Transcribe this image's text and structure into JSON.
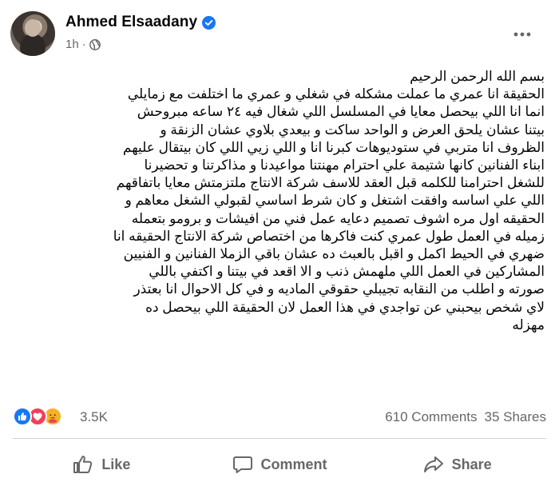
{
  "post": {
    "author": "Ahmed Elsaadany",
    "time": "1h",
    "dot": "·",
    "icons": {
      "verified": "verified-badge-icon",
      "audience": "globe-icon",
      "more": "more-options-icon"
    },
    "body_lines": [
      "بسم الله الرحمن الرحيم",
      "الحقيقة انا عمري ما عملت مشكله في شغلي و عمري ما اختلفت مع زمايلي",
      "انما انا اللي بيحصل معايا في المسلسل اللي شغال فيه ٢٤ ساعه مبروحش",
      "بيتنا عشان يلحق العرض و الواحد ساكت و بيعدي بلاوي عشان الزنقة و",
      "الظروف  انا متربي في ستوديوهات كبرنا انا و اللي زيي اللي كان بيتقال عليهم",
      "ابناء الفنانين كانها شتيمة علي احترام مهنتنا مواعيدنا و مذاكرتنا و تحضيرنا",
      "للشغل احترامنا للكلمه قبل العقد للاسف شركة الانتاج ملتزمتش معايا باتفاقهم",
      "اللي علي اساسه وافقت اشتغل و كان شرط اساسي لقبولي الشغل معاهم و",
      "الحقيقه اول مره اشوف تصميم دعايه عمل فني من افيشات و برومو بتعمله",
      "زميله في العمل طول عمري كنت فاكرها من اختصاص شركة الانتاج الحقيقه انا",
      "ضهري في الحيط اكمل و اقبل بالعبث ده عشان باقي الزملا الفنانين و الفنيين",
      "المشاركين في العمل اللي ملهمش ذنب و الا اقعد في بيتنا و اكتفي باللي",
      "صورته و اطلب من النقابه تجيبلي حقوقي الماديه و في كل الاحوال انا بعتذر",
      "لاي شخص بيحبني عن تواجدي في هذا العمل لان الحقيقة اللي بيحصل ده",
      "مهزله"
    ]
  },
  "stats": {
    "reactions_count": "3.5K",
    "reaction_icons": [
      "like-reaction-icon",
      "love-reaction-icon",
      "care-reaction-icon"
    ],
    "comments": "610 Comments",
    "shares": "35 Shares"
  },
  "actions": {
    "like": "Like",
    "comment": "Comment",
    "share": "Share"
  },
  "colors": {
    "text": "#050505",
    "secondary": "#65676b",
    "brand_blue": "#1877f2",
    "love_red": "#f33e58",
    "care_yellow": "#f7b125",
    "divider": "#ced0d4"
  }
}
